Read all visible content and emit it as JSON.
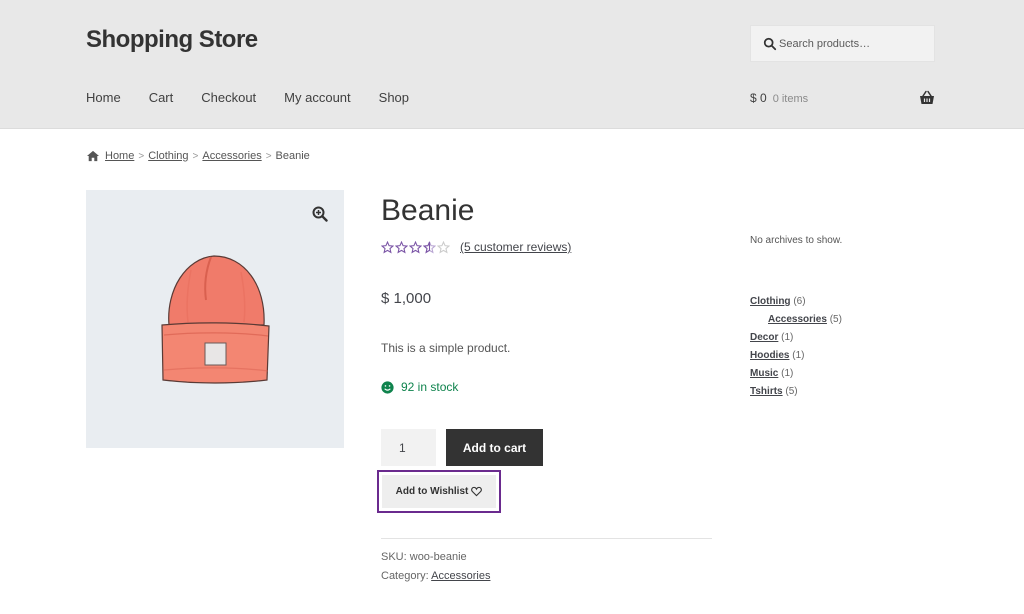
{
  "header": {
    "site_title": "Shopping Store",
    "search_placeholder": "Search products…",
    "nav": [
      "Home",
      "Cart",
      "Checkout",
      "My account",
      "Shop"
    ],
    "cart_amount": "$ 0",
    "cart_count": "0 items"
  },
  "breadcrumb": {
    "items": [
      "Home",
      "Clothing",
      "Accessories"
    ],
    "current": "Beanie",
    "separator": ">"
  },
  "product": {
    "title": "Beanie",
    "rating": 3.5,
    "reviews_link": "(5 customer reviews)",
    "price": "$ 1,000",
    "short_description": "This is a simple product.",
    "stock": "92 in stock",
    "quantity": "1",
    "add_to_cart_label": "Add to cart",
    "wishlist_label": "Add to Wishlist",
    "sku_label": "SKU:",
    "sku_value": "woo-beanie",
    "category_label": "Category:",
    "category_value": "Accessories"
  },
  "sidebar": {
    "archives_note": "No archives to show.",
    "categories": [
      {
        "name": "Clothing",
        "count": "(6)",
        "sub": false
      },
      {
        "name": "Accessories",
        "count": "(5)",
        "sub": true
      },
      {
        "name": "Decor",
        "count": "(1)",
        "sub": false
      },
      {
        "name": "Hoodies",
        "count": "(1)",
        "sub": false
      },
      {
        "name": "Music",
        "count": "(1)",
        "sub": false
      },
      {
        "name": "Tshirts",
        "count": "(5)",
        "sub": false
      }
    ]
  },
  "colors": {
    "header_bg": "#e8e8e8",
    "stock_green": "#0f834d",
    "star_purple": "#7b55a6",
    "wishlist_border": "#6a2a8e",
    "button_dark": "#333333"
  },
  "icons": [
    "search-icon",
    "basket-icon",
    "home-icon",
    "zoom-icon",
    "star-icon",
    "smile-icon",
    "heart-icon"
  ]
}
